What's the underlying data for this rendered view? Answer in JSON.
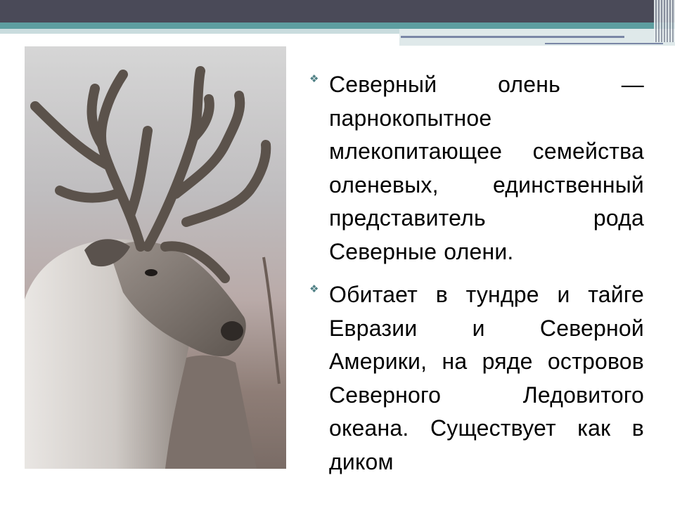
{
  "slide": {
    "bullet_icon": "star-bullet-icon",
    "accent_color": "#5d9ea0",
    "header_color": "#4a4a58",
    "bullets": [
      {
        "text": "Северный олень — парнокопытное млекопитающее семейства оленевых, единственный представитель рода Северные олени."
      },
      {
        "text": "Обитает в тундре и тайге Евразии и Северной Америки, на ряде островов Северного Ледовитого океана. Существует как в диком"
      }
    ]
  }
}
